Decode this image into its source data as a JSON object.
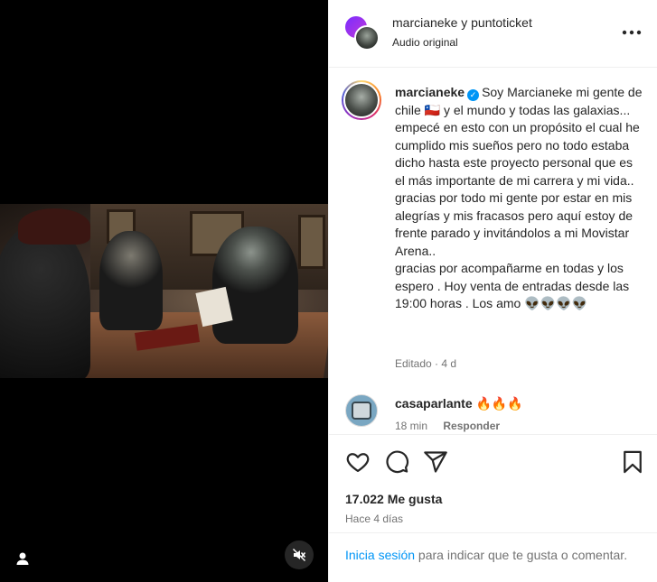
{
  "post": {
    "header": {
      "usernames": "marcianeke y puntoticket",
      "audio": "Audio original"
    },
    "caption": {
      "username": "marcianeke",
      "verified_icon": "verified-badge-icon",
      "text": "Soy Marcianeke mi gente de chile 🇨🇱 y el mundo y todas las galaxias... empecé en esto con un propósito el cual he cumplido mis sueños pero no todo estaba dicho hasta este proyecto personal que es el más importante de mi carrera y mi vida..\ngracias por todo mi gente por estar en mis alegrías y mis fracasos pero aquí estoy de frente parado y invitándolos a mi Movistar Arena..\ngracias por acompañarme en todas y los espero . Hoy venta de entradas desde las 19:00 horas . Los amo 👽👽👽👽",
      "meta": "Editado · 4 d"
    },
    "comments": [
      {
        "username": "casaparlante",
        "text": "🔥🔥🔥",
        "time": "18 min",
        "reply_label": "Responder"
      }
    ],
    "likes": "17.022 Me gusta",
    "date": "Hace 4 días",
    "login_prompt": {
      "link": "Inicia sesión",
      "text": " para indicar que te gusta o comentar."
    }
  },
  "colors": {
    "link_blue": "#0095f6",
    "muted_gray": "#737373",
    "border": "#efefef"
  }
}
